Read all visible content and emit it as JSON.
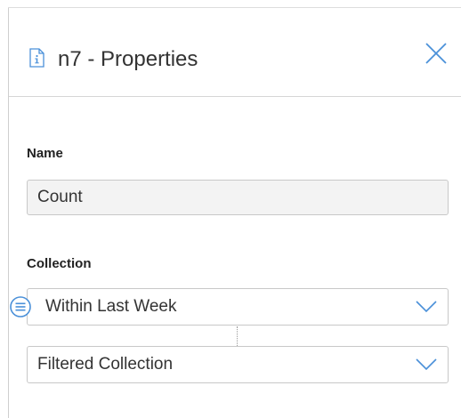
{
  "panel": {
    "title": "n7 - Properties",
    "title_icon": "document-info-icon",
    "close_icon": "close-icon",
    "accent_color": "#4a90d9"
  },
  "name_field": {
    "label": "Name",
    "value": "Count"
  },
  "collection_field": {
    "label": "Collection",
    "primary_select": {
      "value": "Within Last Week",
      "icon": "list-icon"
    },
    "secondary_select": {
      "value": "Filtered Collection"
    }
  }
}
